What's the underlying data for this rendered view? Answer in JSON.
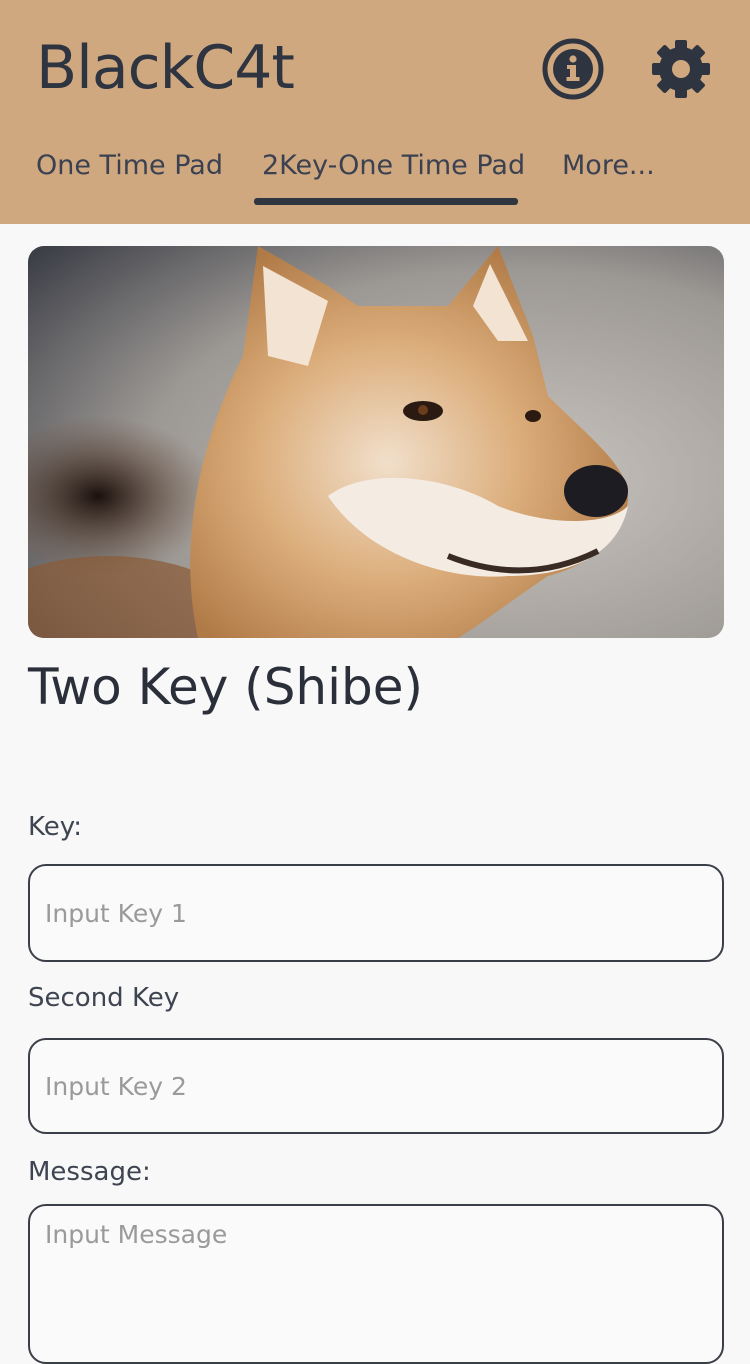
{
  "header": {
    "app_title": "BlackC4t",
    "info_icon": "info-circle-icon",
    "settings_icon": "gear-icon",
    "background_color": "#cfa880"
  },
  "tabs": [
    {
      "label": "One Time Pad",
      "active": false
    },
    {
      "label": "2Key-One Time Pad",
      "active": true
    },
    {
      "label": "More..."
    }
  ],
  "main": {
    "hero_image": "shiba-inu-dog-photo",
    "title": "Two Key (Shibe)",
    "fields": {
      "key_label": "Key:",
      "key_placeholder": "Input Key 1",
      "second_key_label": "Second Key",
      "second_key_placeholder": "Input Key 2",
      "message_label": "Message:",
      "message_placeholder": "Input Message"
    }
  }
}
